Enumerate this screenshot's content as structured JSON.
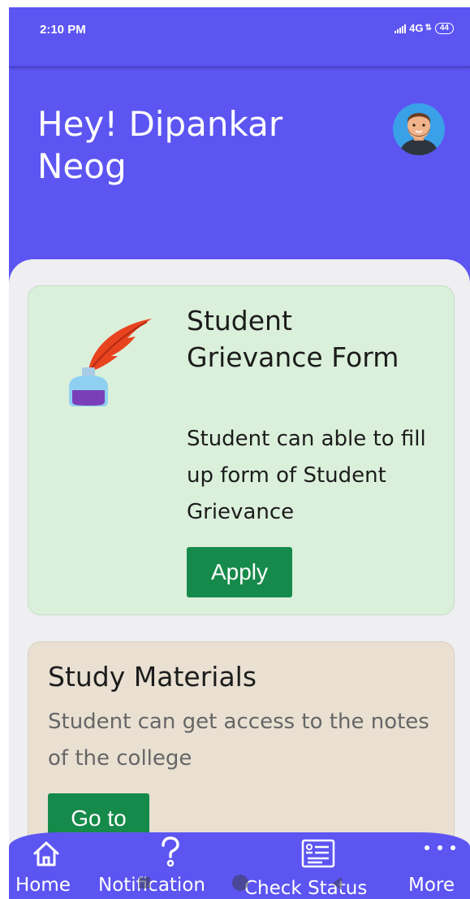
{
  "status_bar": {
    "time": "2:10 PM",
    "network": "4G",
    "battery": "44"
  },
  "header": {
    "greeting": "Hey! Dipankar Neog",
    "avatar_icon": "user-avatar-icon"
  },
  "cards": {
    "grievance": {
      "icon": "quill-inkpot-icon",
      "title": "Student Grievance Form",
      "description": "Student can able to fill up form of Student Grievance",
      "button_label": "Apply"
    },
    "study": {
      "title": "Study Materials",
      "description": "Student can get access to the notes of the college",
      "button_label": "Go to"
    }
  },
  "bottom_nav": {
    "items": [
      {
        "label": "Home",
        "icon": "home-icon"
      },
      {
        "label": "Notification",
        "icon": "question-icon"
      },
      {
        "label": "Check Status",
        "icon": "list-icon"
      },
      {
        "label": "More",
        "icon": "more-icon"
      }
    ]
  },
  "colors": {
    "primary": "#5c55f2",
    "grievance_card_bg": "#dbf0db",
    "study_card_bg": "#e9e0d2",
    "button": "#168a4a"
  }
}
